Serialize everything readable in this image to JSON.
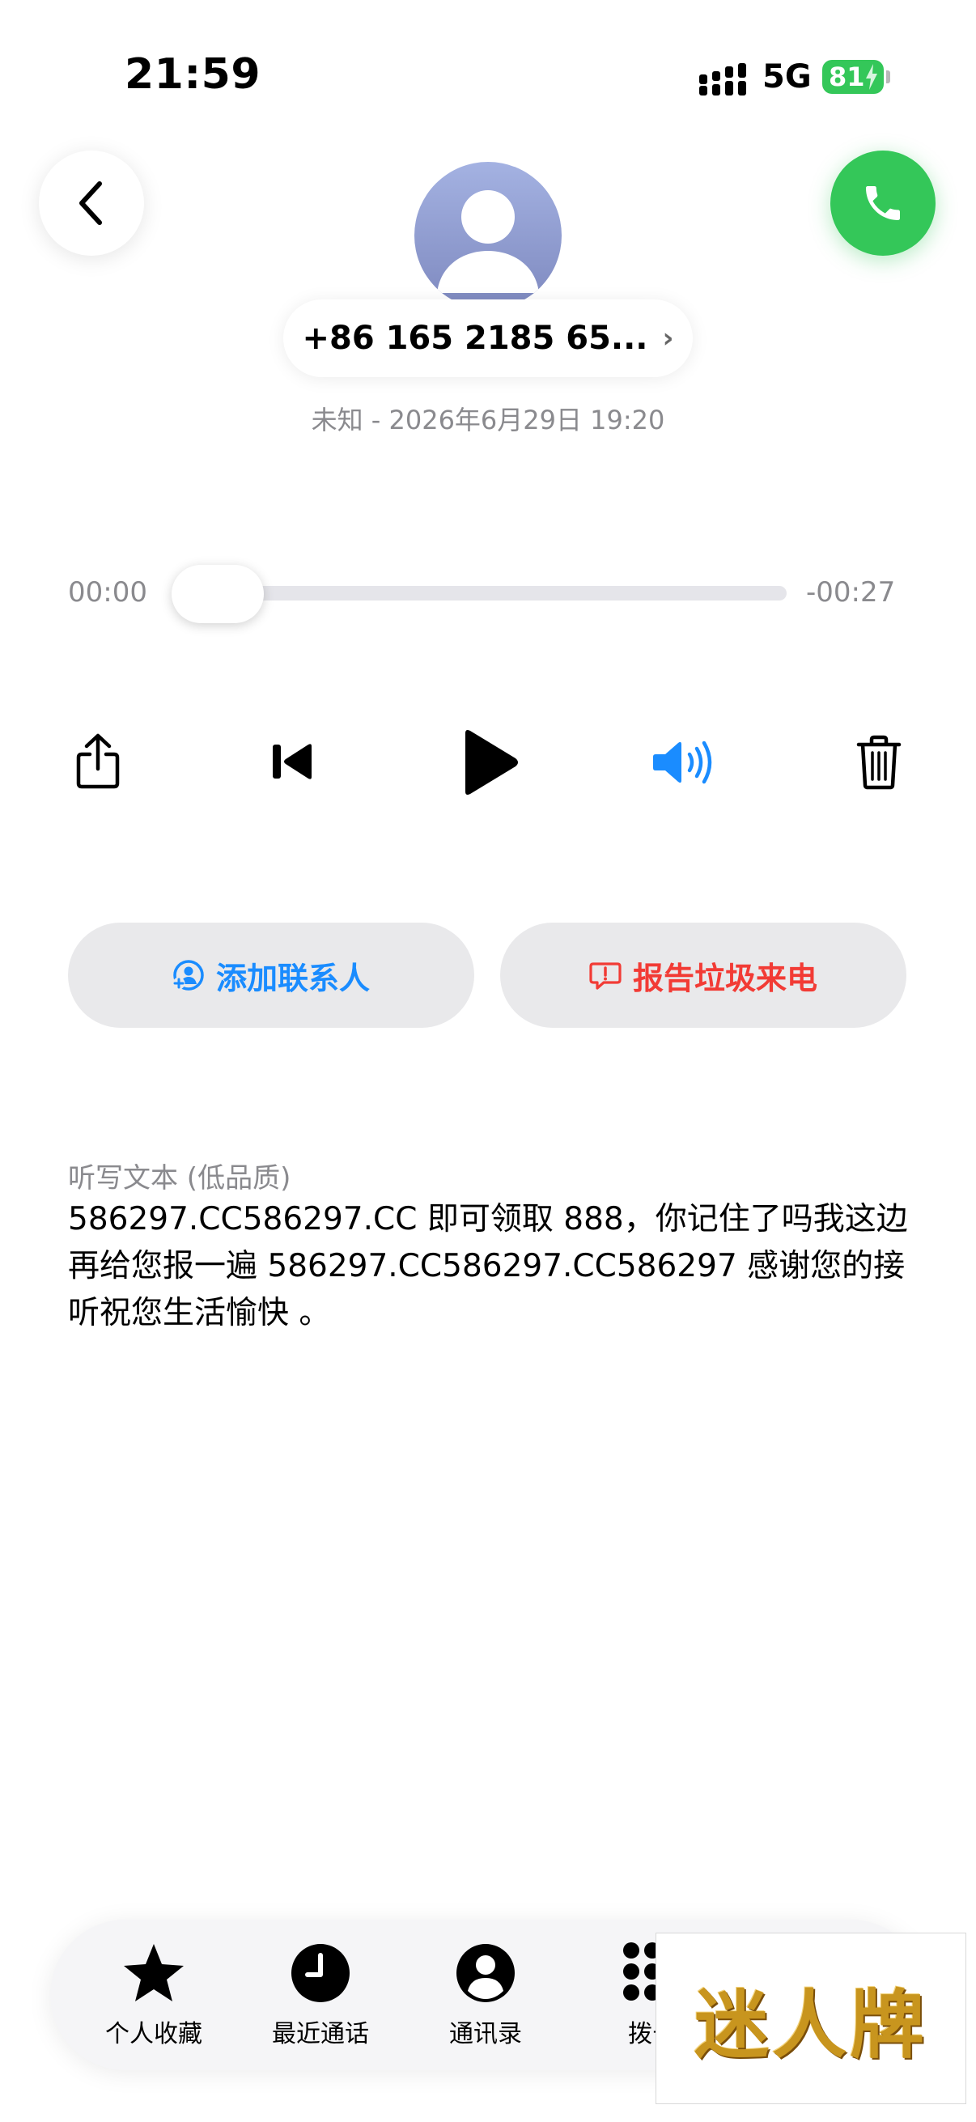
{
  "status_bar": {
    "time": "21:59",
    "network": "5G",
    "battery": "81"
  },
  "caller": {
    "number": "+86 165 2185 65...",
    "meta": "未知 - 2026年6月29日 19:20"
  },
  "player": {
    "elapsed": "00:00",
    "remaining": "-00:27",
    "progress_fraction": 0.0
  },
  "actions": {
    "add_contact": "添加联系人",
    "report_spam": "报告垃圾来电"
  },
  "transcript": {
    "label": "听写文本 (低品质)",
    "text": "586297.CC586297.CC 即可领取 888，你记住了吗我这边再给您报一遍 586297.CC586297.CC586297 感谢您的接听祝您生活愉快 。"
  },
  "tabs": [
    {
      "label": "个人收藏",
      "icon": "star-icon"
    },
    {
      "label": "最近通话",
      "icon": "clock-icon"
    },
    {
      "label": "通讯录",
      "icon": "person-icon"
    },
    {
      "label": "拨号",
      "icon": "keypad-icon"
    }
  ],
  "watermark": {
    "text": "迷人牌"
  },
  "colors": {
    "accent_blue": "#1a8cff",
    "danger_red": "#f23b35",
    "call_green": "#34c759"
  }
}
